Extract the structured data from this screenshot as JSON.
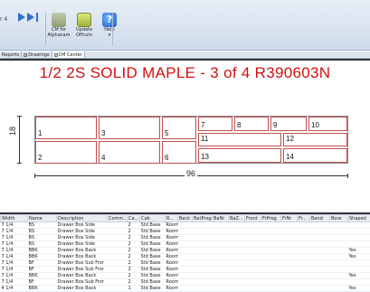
{
  "ribbon": {
    "left_text": "r 4",
    "buttons": [
      {
        "label": "CM for Alphacam",
        "icon": "cnc-icon"
      },
      {
        "label": "Update Offcuts",
        "icon": "update-offcuts-icon"
      },
      {
        "label": "Help",
        "icon": "help-icon"
      }
    ],
    "help_sub": "▾"
  },
  "tabs": [
    {
      "label": "Reports"
    },
    {
      "label": "Drawings"
    },
    {
      "label": "CM Center",
      "active": true
    }
  ],
  "drawing": {
    "title": "1/2 2S SOLID MAPLE  - 3 of 4 R390603N",
    "dim_vertical": "18",
    "dim_horizontal": "96",
    "parts": [
      "1",
      "2",
      "3",
      "4",
      "5",
      "6",
      "7",
      "8",
      "9",
      "10",
      "11",
      "12",
      "13",
      "14"
    ]
  },
  "grid": {
    "columns": [
      "Width",
      "Name",
      "Description",
      "Comm...",
      "Ca...",
      "Cab",
      "R...",
      "Back",
      "BatProg",
      "BaNr",
      "BaZ...",
      "Front",
      "FrProg",
      "FrNr",
      "Fr...",
      "Band",
      "Bore",
      "Shaped"
    ],
    "rows": [
      [
        "7 1/4",
        "BS",
        "Drawer Box Side",
        "",
        "2",
        "Std Base",
        "Room",
        "",
        "",
        "",
        "",
        "",
        "",
        "",
        "",
        "",
        "",
        ""
      ],
      [
        "7 1/4",
        "BS",
        "Drawer Box Side",
        "",
        "2",
        "Std Base",
        "Room",
        "",
        "",
        "",
        "",
        "",
        "",
        "",
        "",
        "",
        "",
        ""
      ],
      [
        "7 1/4",
        "BS",
        "Drawer Box Side",
        "",
        "2",
        "Std Base",
        "Room",
        "",
        "",
        "",
        "",
        "",
        "",
        "",
        "",
        "",
        "",
        ""
      ],
      [
        "7 1/4",
        "BS",
        "Drawer Box Side",
        "",
        "2",
        "Std Base",
        "Room",
        "",
        "",
        "",
        "",
        "",
        "",
        "",
        "",
        "",
        "",
        ""
      ],
      [
        "7 1/4",
        "BBK",
        "Drawer Box Back",
        "",
        "2",
        "Std Base",
        "Room",
        "",
        "",
        "",
        "",
        "",
        "",
        "",
        "",
        "",
        "",
        "Yes"
      ],
      [
        "7 1/4",
        "BBK",
        "Drawer Box Back",
        "",
        "2",
        "Std Base",
        "Room",
        "",
        "",
        "",
        "",
        "",
        "",
        "",
        "",
        "",
        "",
        "Yes"
      ],
      [
        "7 1/4",
        "BF",
        "Drawer Box Sub Fror",
        "",
        "2",
        "Std Base",
        "Room",
        "",
        "",
        "",
        "",
        "",
        "",
        "",
        "",
        "",
        "",
        ""
      ],
      [
        "7 1/4",
        "BF",
        "Drawer Box Sub Fror",
        "",
        "2",
        "Std Base",
        "Room",
        "",
        "",
        "",
        "",
        "",
        "",
        "",
        "",
        "",
        "",
        ""
      ],
      [
        "7 1/4",
        "BBK",
        "Drawer Box Back",
        "",
        "2",
        "Std Base",
        "Room",
        "",
        "",
        "",
        "",
        "",
        "",
        "",
        "",
        "",
        "",
        "Yes"
      ],
      [
        "7 1/4",
        "BF",
        "Drawer Box Sub Fror",
        "",
        "2",
        "Std Base",
        "Room",
        "",
        "",
        "",
        "",
        "",
        "",
        "",
        "",
        "",
        "",
        ""
      ],
      [
        "4 1/4",
        "BBK",
        "Drawer Box Back",
        "",
        "1",
        "Std Base",
        "Room",
        "",
        "",
        "",
        "",
        "",
        "",
        "",
        "",
        "",
        "",
        "Yes"
      ]
    ]
  }
}
